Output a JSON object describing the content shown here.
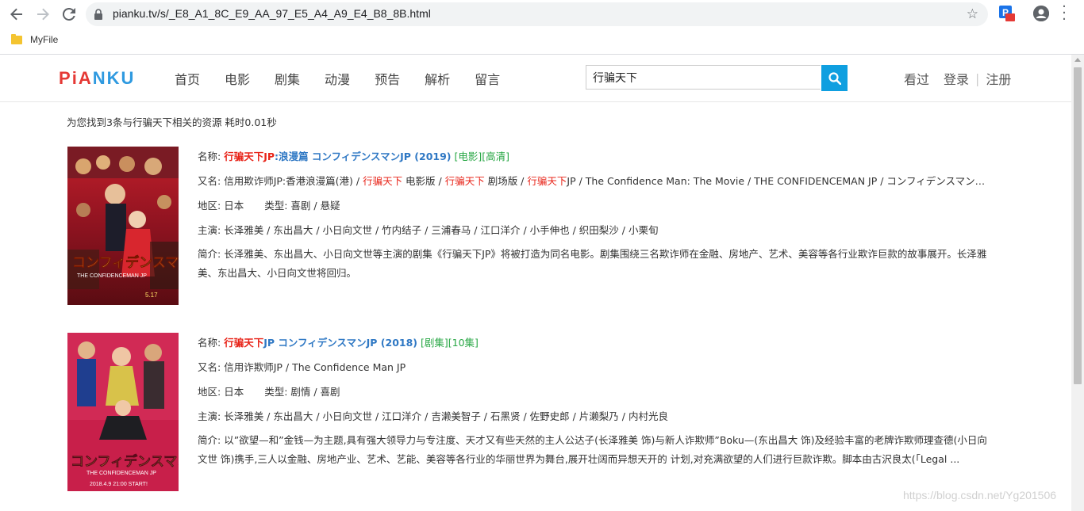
{
  "browser": {
    "url": "pianku.tv/s/_E8_A1_8C_E9_AA_97_E5_A4_A9_E4_B8_8B.html",
    "bookmark": "MyFile"
  },
  "site": {
    "logo": "PiANKU",
    "nav": [
      "首页",
      "电影",
      "剧集",
      "动漫",
      "预告",
      "解析",
      "留言"
    ],
    "search_value": "行骗天下",
    "user_nav": {
      "watched": "看过",
      "login": "登录",
      "register": "注册"
    }
  },
  "summary": "为您找到3条与行骗天下相关的资源 耗时0.01秒",
  "colors": {
    "keyword": "#e8251a",
    "title": "#2f78c4",
    "tag": "#28a745",
    "search_button": "#0f9fe0"
  },
  "results": [
    {
      "label_name": "名称:",
      "title_kw": "行骗天下JP",
      "title_rest": ":浪漫篇 コンフィデンスマンJP (2019)",
      "tags": "[电影][高清]",
      "label_alias": "又名:",
      "alias_parts": [
        "信用欺诈师JP:香港浪漫篇(港) / ",
        "行骗天下",
        " 电影版 / ",
        "行骗天下",
        " 剧场版 / ",
        "行骗天下",
        "JP / The Confidence Man: The Movie / THE CONFIDENCEMAN JP / コンフィデンスマンJP ロマンス編"
      ],
      "label_region": "地区:",
      "region": "日本",
      "label_genre": "类型:",
      "genre": "喜剧 / 悬疑",
      "label_cast": "主演:",
      "cast": "长泽雅美 / 东出昌大 / 小日向文世 / 竹内结子 / 三浦春马 / 江口洋介 / 小手伸也 / 织田梨沙 / 小栗旬",
      "label_intro": "简介:",
      "intro": "长泽雅美、东出昌大、小日向文世等主演的剧集《行骗天下JP》将被打造为同名电影。剧集围绕三名欺诈师在金融、房地产、艺术、美容等各行业欺诈巨款的故事展开。长泽雅美、东出昌大、小日向文世将回归。"
    },
    {
      "label_name": "名称:",
      "title_kw": "行骗天下",
      "title_rest": "JP コンフィデンスマンJP (2018)",
      "tags": "[剧集][10集]",
      "label_alias": "又名:",
      "alias_parts": [
        "信用诈欺师JP / The Confidence Man JP"
      ],
      "label_region": "地区:",
      "region": "日本",
      "label_genre": "类型:",
      "genre": "剧情 / 喜剧",
      "label_cast": "主演:",
      "cast": "长泽雅美 / 东出昌大 / 小日向文世 / 江口洋介 / 吉濑美智子 / 石黑贤 / 佐野史郎 / 片濑梨乃 / 内村光良",
      "label_intro": "简介:",
      "intro": "以”欲望—和”金钱—为主题,具有强大领导力与专注度、天才又有些天然的主人公达子(长泽雅美 饰)与新人诈欺师”Boku—(东出昌大 饰)及经验丰富的老牌诈欺师理查德(小日向文世 饰)携手,三人以金融、房地产业、艺术、艺能、美容等各行业的华丽世界为舞台,展开壮阔而异想天开的 计划,对充满欲望的人们进行巨款诈欺。脚本由古沢良太(「Legal ..."
    }
  ],
  "watermark": "https://blog.csdn.net/Yg201506"
}
